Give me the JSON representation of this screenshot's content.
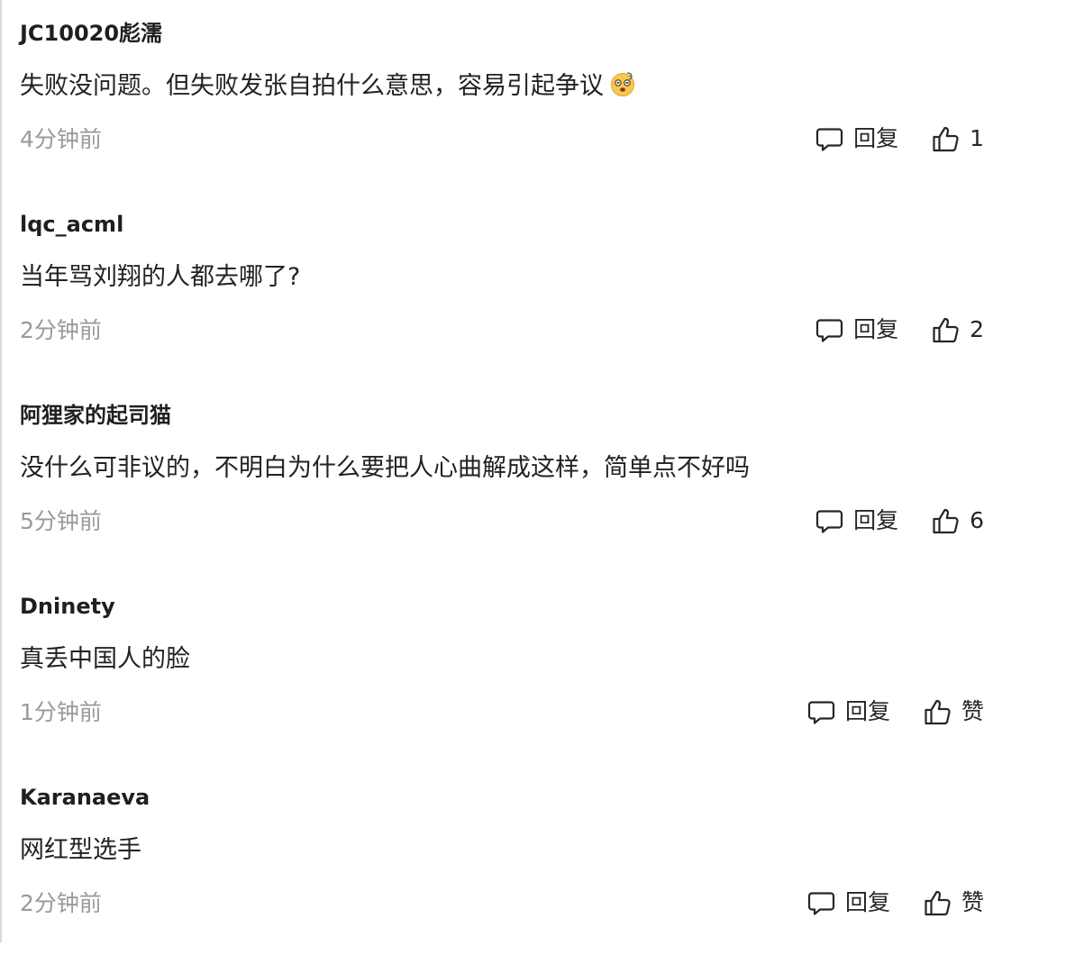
{
  "comments": [
    {
      "username": "JC10020彪濡",
      "content": "失败没问题。但失败发张自拍什么意思，容易引起争议",
      "has_emoji": true,
      "emoji_icon": "dizzy-face-emoji",
      "time": "4分钟前",
      "reply_label": "回复",
      "like_label": "1"
    },
    {
      "username": "lqc_acml",
      "content": "当年骂刘翔的人都去哪了?",
      "has_emoji": false,
      "time": "2分钟前",
      "reply_label": "回复",
      "like_label": "2"
    },
    {
      "username": "阿狸家的起司猫",
      "content": "没什么可非议的，不明白为什么要把人心曲解成这样，简单点不好吗",
      "has_emoji": false,
      "time": "5分钟前",
      "reply_label": "回复",
      "like_label": "6"
    },
    {
      "username": "Dninety",
      "content": "真丢中国人的脸",
      "has_emoji": false,
      "time": "1分钟前",
      "reply_label": "回复",
      "like_label": "赞"
    },
    {
      "username": "Karanaeva",
      "content": "网红型选手",
      "has_emoji": false,
      "time": "2分钟前",
      "reply_label": "回复",
      "like_label": "赞"
    }
  ],
  "icons": {
    "reply": "comment-bubble-icon",
    "like": "thumbs-up-icon"
  },
  "colors": {
    "text": "#1f1f1f",
    "time": "#9a9a9a",
    "action": "#262626"
  }
}
